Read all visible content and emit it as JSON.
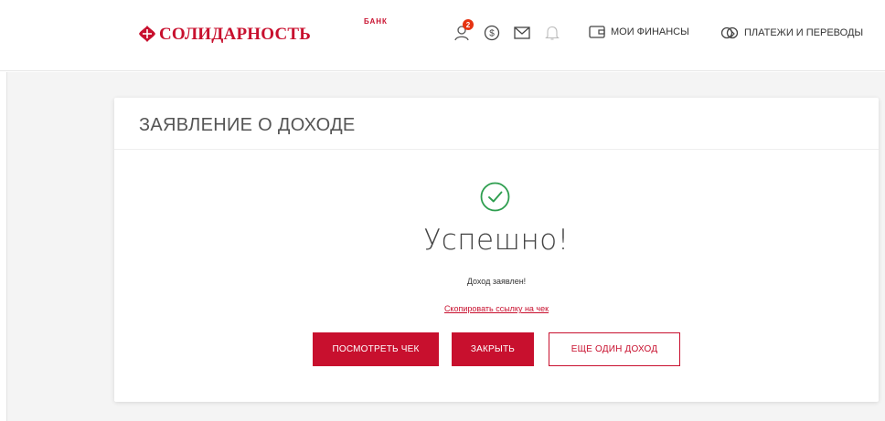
{
  "header": {
    "logo_text": "СОЛИДАРНОСТЬ",
    "logo_bank": "БАНК",
    "notifications_count": "2",
    "nav": {
      "finance_label": "МОИ ФИНАНСЫ",
      "payments_label": "ПЛАТЕЖИ И ПЕРЕВОДЫ"
    },
    "icons": [
      "user-icon",
      "dollar-icon",
      "mail-icon",
      "bell-icon",
      "wallet-icon",
      "transfer-icon"
    ]
  },
  "card": {
    "title": "ЗАЯВЛЕНИЕ О ДОХОДЕ",
    "success_title": "Успешно!",
    "success_message": "Доход заявлен!",
    "copy_link_label": "Скопировать ссылку на чек",
    "buttons": {
      "view_receipt": "ПОСМОТРЕТЬ ЧЕК",
      "close": "ЗАКРЫТЬ",
      "another_income": "ЕЩЕ ОДИН ДОХОД"
    }
  },
  "colors": {
    "brand": "#c8102e",
    "success": "#2e9e4f",
    "background": "#f4f4f4"
  }
}
